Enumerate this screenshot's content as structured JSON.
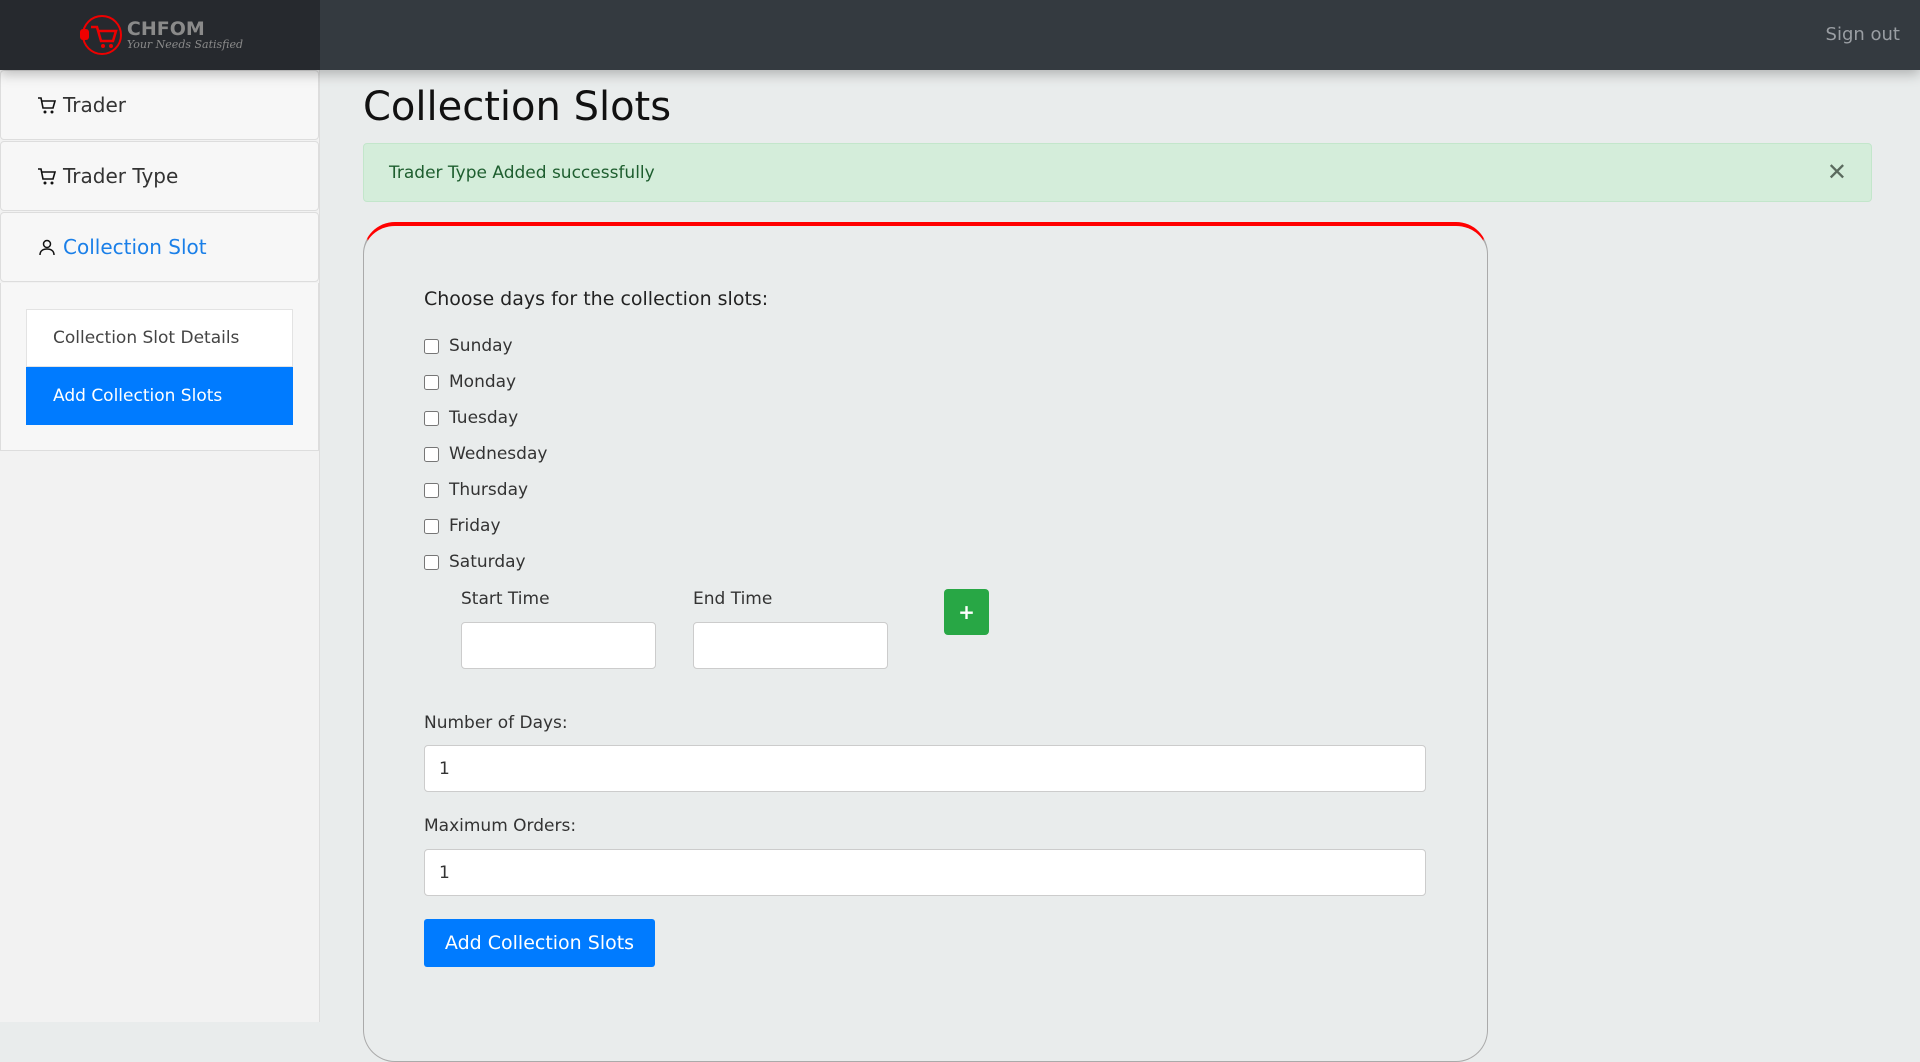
{
  "header": {
    "brand_name": "CHFOM",
    "brand_tagline": "Your Needs Satisfied",
    "sign_out": "Sign out"
  },
  "sidebar": {
    "items": [
      {
        "label": "Trader",
        "icon": "cart-icon"
      },
      {
        "label": "Trader Type",
        "icon": "cart-icon"
      },
      {
        "label": "Collection Slot",
        "icon": "user-icon"
      }
    ],
    "sub_items": [
      {
        "label": "Collection Slot Details"
      },
      {
        "label": "Add Collection Slots"
      }
    ]
  },
  "page": {
    "title": "Collection Slots"
  },
  "alert": {
    "message": "Trader Type Added successfully",
    "close": "✕"
  },
  "form": {
    "days_label": "Choose days for the collection slots:",
    "days": [
      "Sunday",
      "Monday",
      "Tuesday",
      "Wednesday",
      "Thursday",
      "Friday",
      "Saturday"
    ],
    "start_time_label": "Start Time",
    "start_time_value": "",
    "end_time_label": "End Time",
    "end_time_value": "",
    "add_time_button": "+",
    "number_of_days_label": "Number of Days:",
    "number_of_days_value": "1",
    "maximum_orders_label": "Maximum Orders:",
    "maximum_orders_value": "1",
    "submit_label": "Add Collection Slots"
  },
  "colors": {
    "accent": "#007bff",
    "success": "#28a745",
    "card_top": "#ff0000",
    "header": "#343a40"
  }
}
